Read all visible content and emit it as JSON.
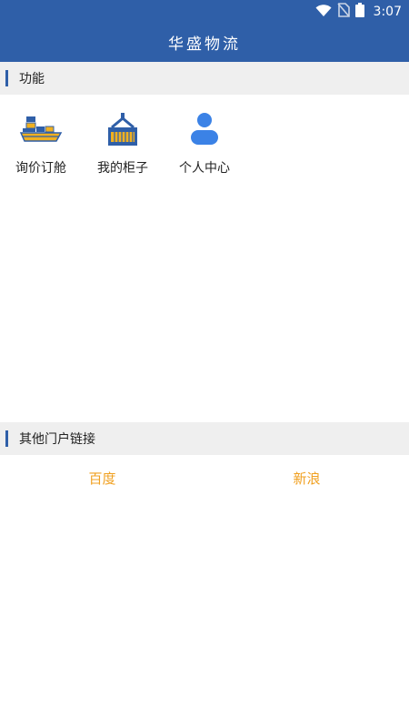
{
  "status_bar": {
    "time": "3:07",
    "icons": [
      "wifi-icon",
      "no-sim-icon",
      "battery-icon"
    ]
  },
  "app_bar": {
    "title": "华盛物流"
  },
  "functions_section": {
    "title": "功能",
    "items": [
      {
        "label": "询价订舱",
        "icon": "cargo-ship-icon"
      },
      {
        "label": "我的柜子",
        "icon": "container-icon"
      },
      {
        "label": "个人中心",
        "icon": "user-icon"
      }
    ]
  },
  "links_section": {
    "title": "其他门户链接",
    "links": [
      {
        "label": "百度"
      },
      {
        "label": "新浪"
      }
    ]
  },
  "colors": {
    "primary": "#2f5fa8",
    "section_bg": "#efefef",
    "link": "#f0a020"
  }
}
